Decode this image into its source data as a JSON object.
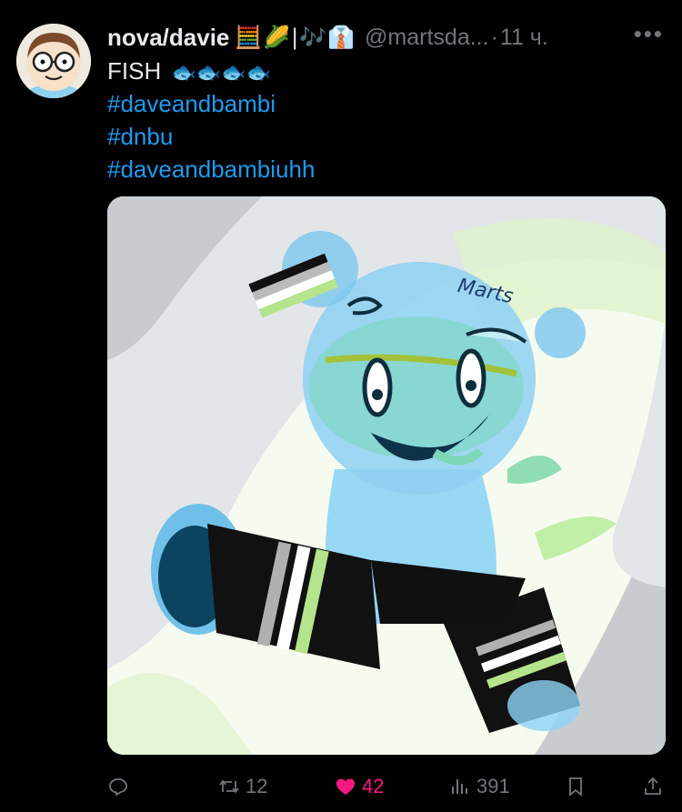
{
  "tweet": {
    "display_name": "nova/davie",
    "name_emoji": "🧮🌽|🎶👔",
    "handle": "@martsda...",
    "separator": "·",
    "time": "11 ч.",
    "more_label": "•••",
    "text": "FISH",
    "fish_emoji": "🐟🐟🐟🐟",
    "hashtags": [
      "#daveandbambi",
      "#dnbu",
      "#daveandbambiuhh"
    ],
    "media_signature": "Marts"
  },
  "actions": {
    "retweets": "12",
    "likes": "42",
    "views": "391"
  },
  "icons": {
    "reply": "reply-icon",
    "retweet": "retweet-icon",
    "like": "heart-icon",
    "views": "views-icon",
    "bookmark": "bookmark-icon",
    "share": "share-icon"
  },
  "colors": {
    "link": "#1d9bf0",
    "secondary": "#71767b",
    "like": "#f91880"
  }
}
